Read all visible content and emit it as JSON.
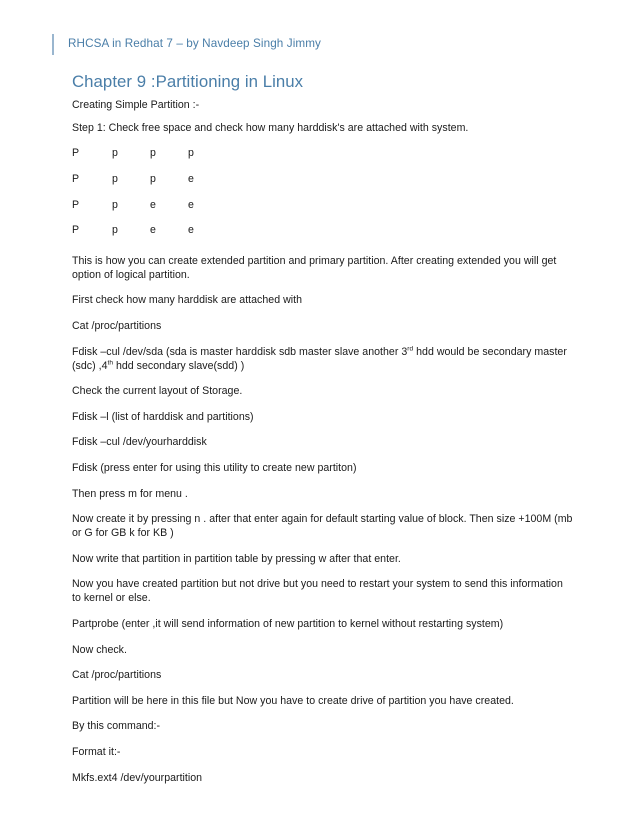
{
  "document": {
    "header": {
      "title": "RHCSA in Redhat 7  – by Navdeep Singh Jimmy",
      "accent_color": "#9ab6cf",
      "text_color": "#4a7ea8"
    },
    "chapter_title": "Chapter 9 :Partitioning in Linux",
    "chapter_title_color": "#4a7ea8",
    "body_text_color": "#1a1a1a",
    "page_background": "#ffffff",
    "paragraphs": {
      "p1": "Creating Simple Partition :-",
      "p2": "Step 1: Check free space and check how many harddisk's are attached with system.",
      "p3": "This is how you can create extended partition and primary partition. After creating extended you will get option of logical partition.",
      "p4": "First check how many harddisk are attached with",
      "p5": "Cat  /proc/partitions",
      "p6_a": "Fdisk –cul /dev/sda  (sda is master harddisk sdb master slave another 3",
      "p6_sup1": "rd",
      "p6_b": " hdd would be secondary master (sdc) ,4",
      "p6_sup2": "th",
      "p6_c": " hdd secondary slave(sdd) )",
      "p7": "Check the current layout of Storage.",
      "p8": "Fdisk –l  (list of harddisk and partitions)",
      "p9": "Fdisk –cul /dev/yourharddisk",
      "p10": "Fdisk  (press enter for using this utility to create new partiton)",
      "p11": "Then press m for menu .",
      "p12": "Now create it by pressing n . after that enter again for default starting value of block. Then size +100M (mb or G for GB k for KB )",
      "p13": "Now write that partition in partition table by pressing w after that enter.",
      "p14": "Now you have created partition but not drive but you need to restart your system to send this information to kernel or else.",
      "p15": "Partprobe (enter ,it will send information of new partition to kernel without restarting system)",
      "p16": "Now check.",
      "p17": "Cat /proc/partitions",
      "p18": "Partition will be here in this file but Now you have to create drive of partition you have created.",
      "p19": "By this command:-",
      "p20": "Format it:-",
      "p21": "Mkfs.ext4 /dev/yourpartition"
    },
    "partition_table": {
      "rows": [
        [
          "P",
          "p",
          "p",
          "p"
        ],
        [
          "P",
          "p",
          "p",
          "e"
        ],
        [
          "P",
          "p",
          "e",
          "e"
        ],
        [
          "P",
          "p",
          "e",
          "e"
        ]
      ]
    }
  }
}
